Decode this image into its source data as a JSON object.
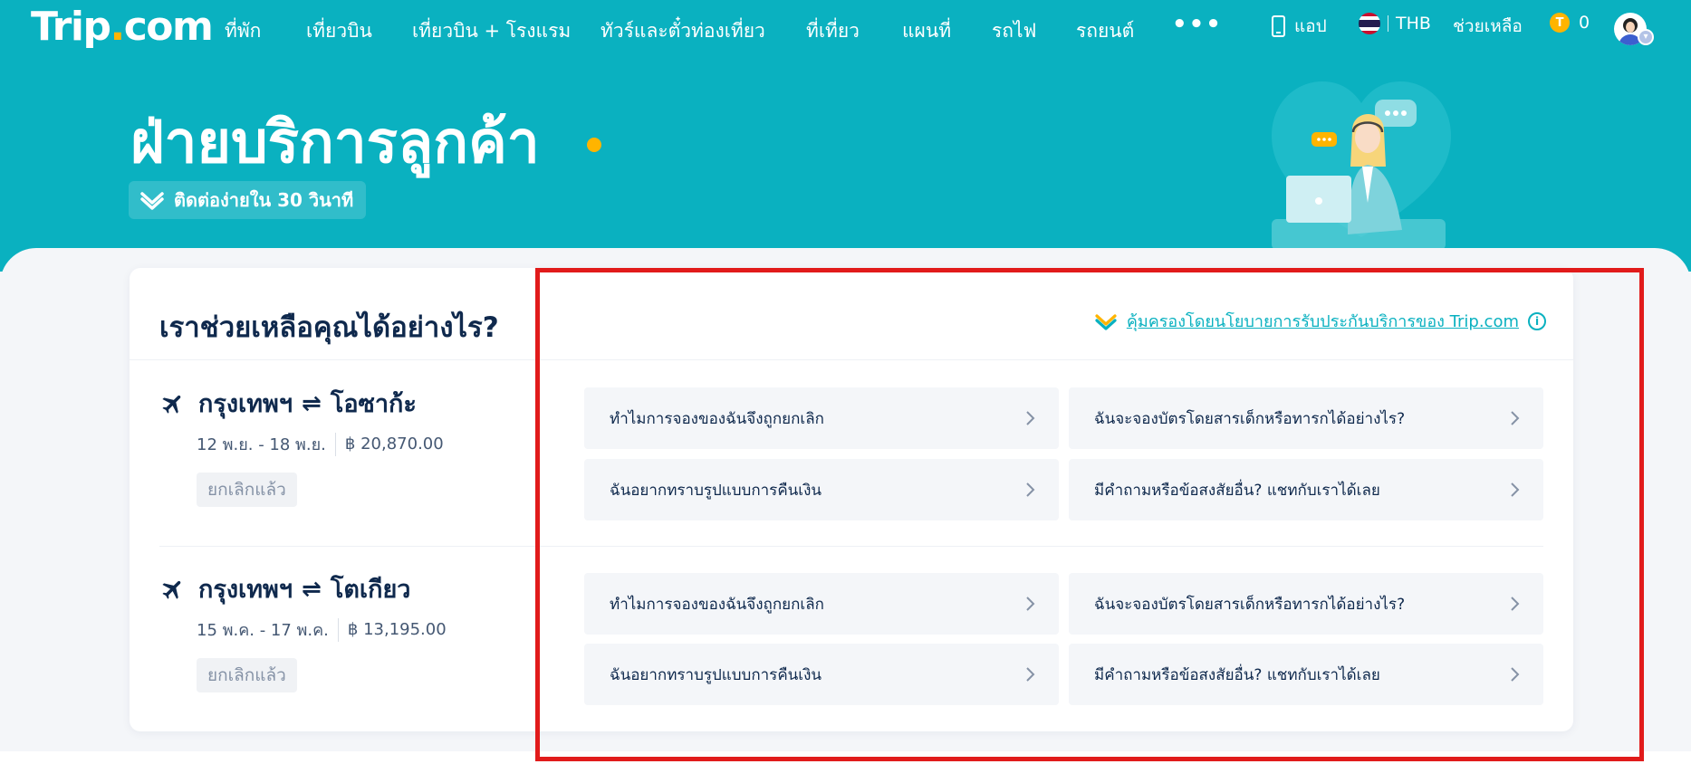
{
  "nav": {
    "logo": {
      "main": "Trip",
      "dot": ".",
      "suffix": "com"
    },
    "items": [
      "ที่พัก",
      "เที่ยวบิน",
      "เที่ยวบิน + โรงแรม",
      "ทัวร์และตั๋วท่องเที่ยว",
      "ที่เที่ยว",
      "แผนที่",
      "รถไฟ",
      "รถยนต์"
    ],
    "more": "•••",
    "app_label": "แอป",
    "currency": "THB",
    "help": "ช่วยเหลือ",
    "coin_symbol": "T",
    "coins": "0"
  },
  "hero": {
    "title": "ฝ่ายบริการลูกค้า",
    "badge": "ติดต่อง่ายใน 30 วินาที"
  },
  "card": {
    "title": "เราช่วยเหลือคุณได้อย่างไร?",
    "guarantee": "คุ้มครองโดยนโยบายการรับประกันบริการของ Trip.com",
    "trips": [
      {
        "from": "กรุงเทพฯ",
        "swap": "⇌",
        "to": "โอซาก้ะ",
        "dates": "12 พ.ย. - 18 พ.ย.",
        "price": "฿ 20,870.00",
        "status": "ยกเลิกแล้ว",
        "faqs": [
          "ทำไมการจองของฉันจึงถูกยกเลิก",
          "ฉันจะจองบัตรโดยสารเด็กหรือทารกได้อย่างไร?",
          "ฉันอยากทราบรูปแบบการคืนเงิน",
          "มีคำถามหรือข้อสงสัยอื่น? แชทกับเราได้เลย"
        ]
      },
      {
        "from": "กรุงเทพฯ",
        "swap": "⇌",
        "to": "โตเกียว",
        "dates": "15 พ.ค. - 17 พ.ค.",
        "price": "฿ 13,195.00",
        "status": "ยกเลิกแล้ว",
        "faqs": [
          "ทำไมการจองของฉันจึงถูกยกเลิก",
          "ฉันจะจองบัตรโดยสารเด็กหรือทารกได้อย่างไร?",
          "ฉันอยากทราบรูปแบบการคืนเงิน",
          "มีคำถามหรือข้อสงสัยอื่น? แชทกับเราได้เลย"
        ]
      }
    ]
  },
  "colors": {
    "brand": "#0ab1c0",
    "accent": "#ffb400",
    "highlight": "#e11b1b"
  }
}
